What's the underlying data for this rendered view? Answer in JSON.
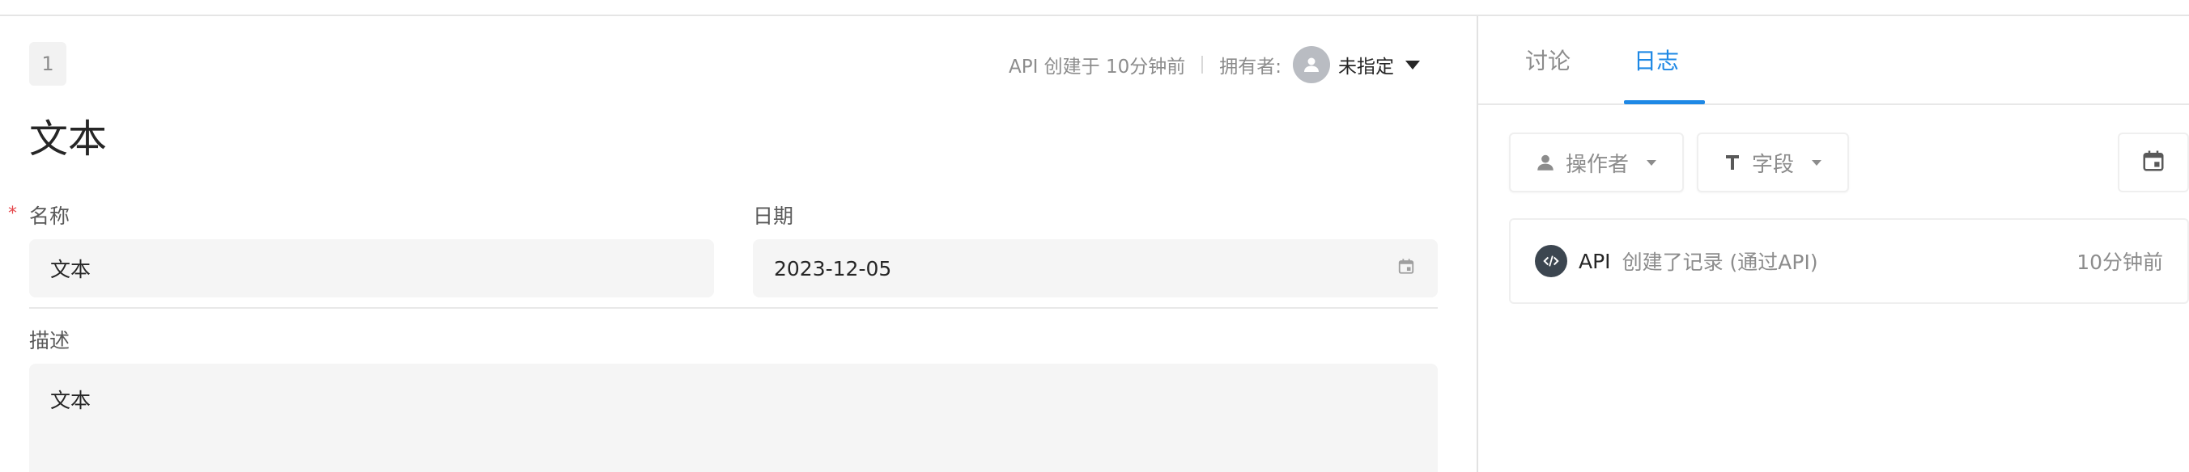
{
  "record": {
    "number": "1",
    "title": "文本",
    "meta_created": "API 创建于 10分钟前",
    "owner_label": "拥有者:",
    "owner_value": "未指定"
  },
  "fields": {
    "name": {
      "label": "名称",
      "value": "文本",
      "required": true
    },
    "date": {
      "label": "日期",
      "value": "2023-12-05"
    },
    "description": {
      "label": "描述",
      "value": "文本"
    }
  },
  "side": {
    "tabs": [
      {
        "label": "讨论",
        "active": false
      },
      {
        "label": "日志",
        "active": true
      }
    ],
    "filters": {
      "operator": "操作者",
      "field": "字段"
    },
    "log": {
      "actor": "API",
      "text": "创建了记录 (通过API)",
      "time": "10分钟前"
    }
  },
  "colors": {
    "accent": "#1e88e5",
    "required": "#e5484d",
    "field_bg": "#f5f5f5"
  }
}
